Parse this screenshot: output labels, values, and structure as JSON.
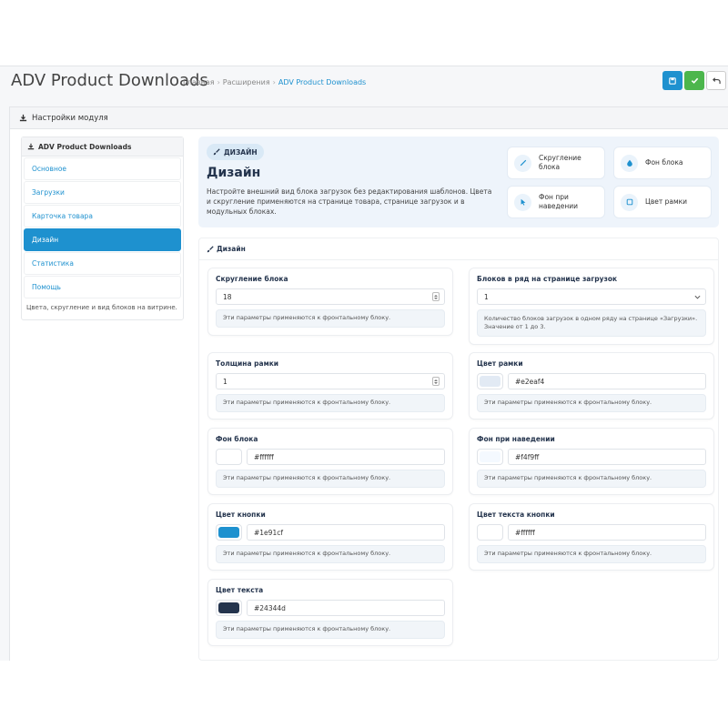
{
  "header": {
    "title": "ADV Product Downloads",
    "breadcrumb": [
      "Главная",
      "Расширения",
      "ADV Product Downloads"
    ]
  },
  "panel": {
    "title": "Настройки модуля"
  },
  "sidebar": {
    "title": "ADV Product Downloads",
    "items": [
      {
        "label": "Основное"
      },
      {
        "label": "Загрузки"
      },
      {
        "label": "Карточка товара"
      },
      {
        "label": "Дизайн",
        "active": true
      },
      {
        "label": "Статистика"
      },
      {
        "label": "Помощь"
      }
    ],
    "note": "Цвета, скругление и вид блоков на витрине."
  },
  "hero": {
    "badge": "ДИЗАЙН",
    "title": "Дизайн",
    "description": "Настройте внешний вид блока загрузок без редактирования шаблонов. Цвета и скругление применяются на странице товара, странице загрузок и в модульных блоках.",
    "chips": [
      {
        "label": "Скругление блока",
        "icon": "pen-icon"
      },
      {
        "label": "Фон блока",
        "icon": "drop-icon"
      },
      {
        "label": "Фон при наведении",
        "icon": "cursor-icon"
      },
      {
        "label": "Цвет рамки",
        "icon": "square-icon"
      }
    ]
  },
  "section": {
    "title": "Дизайн",
    "fields": {
      "radius": {
        "label": "Скругление блока",
        "value": "18",
        "hint": "Эти параметры применяются к фронтальному блоку."
      },
      "per_row": {
        "label": "Блоков в ряд на странице загрузок",
        "value": "1",
        "hint": "Количество блоков загрузок в одном ряду на странице «Загрузки». Значение от 1 до 3."
      },
      "border_width": {
        "label": "Толщина рамки",
        "value": "1",
        "hint": "Эти параметры применяются к фронтальному блоку."
      },
      "border_color": {
        "label": "Цвет рамки",
        "value": "#e2eaf4",
        "hint": "Эти параметры применяются к фронтальному блоку."
      },
      "bg": {
        "label": "Фон блока",
        "value": "#ffffff",
        "hint": "Эти параметры применяются к фронтальному блоку."
      },
      "hover_bg": {
        "label": "Фон при наведении",
        "value": "#f4f9ff",
        "hint": "Эти параметры применяются к фронтальному блоку."
      },
      "btn_color": {
        "label": "Цвет кнопки",
        "value": "#1e91cf",
        "hint": "Эти параметры применяются к фронтальному блоку."
      },
      "btn_text": {
        "label": "Цвет текста кнопки",
        "value": "#ffffff",
        "hint": "Эти параметры применяются к фронтальному блоку."
      },
      "text_color": {
        "label": "Цвет текста",
        "value": "#24344d",
        "hint": "Эти параметры применяются к фронтальному блоку."
      }
    }
  },
  "colors": {
    "primary": "#1e91cf",
    "success": "#4cb64c",
    "dark": "#24344d"
  }
}
